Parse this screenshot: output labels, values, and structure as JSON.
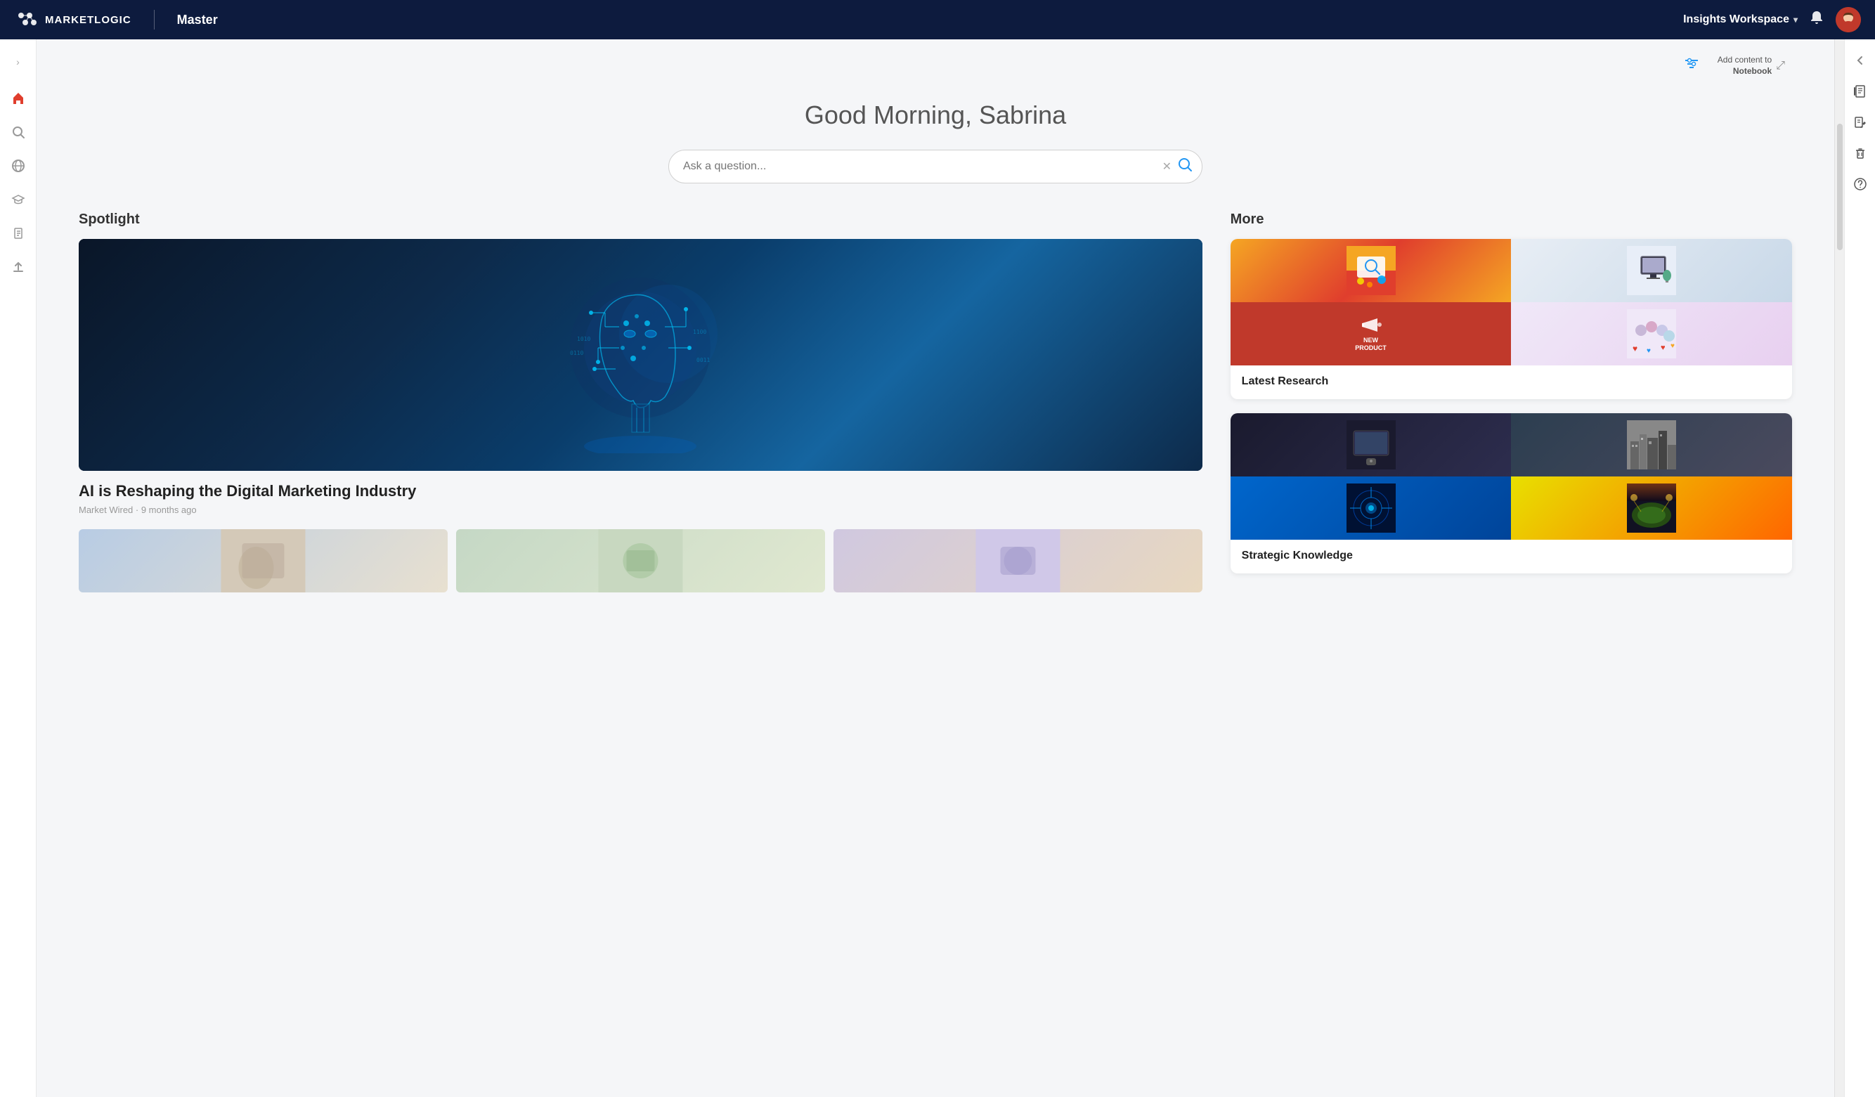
{
  "app": {
    "logo_text": "MARKETLOGIC",
    "app_name": "Master"
  },
  "header": {
    "workspace_label": "Insights Workspace",
    "workspace_chevron": "▾",
    "notebook_add_line1": "Add content to",
    "notebook_add_line2": "Notebook"
  },
  "greeting": "Good Morning, Sabrina",
  "search": {
    "placeholder": "Ask a question..."
  },
  "sidebar_left": {
    "items": [
      {
        "icon": "›",
        "name": "expand-icon",
        "label": "Expand sidebar"
      },
      {
        "icon": "⌂",
        "name": "home-icon",
        "label": "Home"
      },
      {
        "icon": "🔍",
        "name": "search-icon",
        "label": "Search"
      },
      {
        "icon": "🌐",
        "name": "globe-icon",
        "label": "Explore"
      },
      {
        "icon": "🎓",
        "name": "learn-icon",
        "label": "Learn"
      },
      {
        "icon": "📋",
        "name": "reports-icon",
        "label": "Reports"
      },
      {
        "icon": "⬆",
        "name": "upload-icon",
        "label": "Upload"
      }
    ]
  },
  "sidebar_right": {
    "items": [
      {
        "icon": "‹",
        "name": "collapse-icon",
        "label": "Collapse"
      },
      {
        "icon": "📓",
        "name": "notebook-icon",
        "label": "Notebook"
      },
      {
        "icon": "✏",
        "name": "edit-icon",
        "label": "Edit"
      },
      {
        "icon": "🗑",
        "name": "trash-icon",
        "label": "Trash"
      },
      {
        "icon": "?",
        "name": "help-icon",
        "label": "Help"
      }
    ]
  },
  "spotlight": {
    "section_label": "Spotlight",
    "article_title": "AI is Reshaping the Digital Marketing Industry",
    "article_source": "Market Wired",
    "article_time": "9 months ago",
    "article_meta": "Market Wired · 9 months ago"
  },
  "more": {
    "section_label": "More",
    "card1": {
      "label": "Latest Research"
    },
    "card2": {
      "label": "Strategic Knowledge"
    }
  },
  "filter_icon_title": "Filters",
  "expand_icon_title": "Expand"
}
